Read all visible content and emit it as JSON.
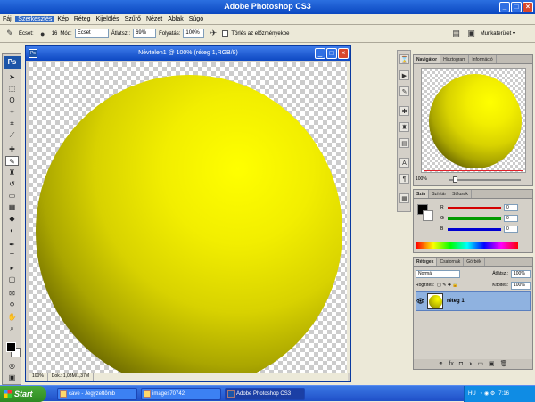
{
  "app": {
    "title": "Adobe Photoshop CS3",
    "logo": "Ps"
  },
  "menu": [
    "Fájl",
    "Szerkesztés",
    "Kép",
    "Réteg",
    "Kijelölés",
    "Szűrő",
    "Nézet",
    "Ablak",
    "Súgó"
  ],
  "options": {
    "brush_label": "Ecset:",
    "brush_size": "16",
    "mode_label": "Mód:",
    "mode_value": "Ecset",
    "opacity_label": "Átlátsz.:",
    "opacity_value": "69%",
    "flow_label": "Folyatás:",
    "flow_value": "100%",
    "erase_history": "Törlés az előzményekbe",
    "workspace": "Munkaterület ▾"
  },
  "document": {
    "title": "Névtelen1 @ 100% (réteg 1,RGB/8)",
    "zoom": "100%",
    "doc_info": "Dok.: 1,03M/1,37M"
  },
  "navigator": {
    "tabs": [
      "Navigátor",
      "Hisztogram",
      "Információ"
    ],
    "zoom": "100%"
  },
  "color": {
    "tabs": [
      "Szín",
      "Színtár",
      "Stílusok"
    ],
    "channels": [
      {
        "label": "R",
        "value": "0",
        "color": "#d40000"
      },
      {
        "label": "G",
        "value": "0",
        "color": "#009a00"
      },
      {
        "label": "B",
        "value": "0",
        "color": "#0000d0"
      }
    ]
  },
  "layers": {
    "tabs": [
      "Rétegek",
      "Csatornák",
      "Görbék"
    ],
    "blend_mode": "Normál",
    "opacity_label": "Átlátsz.:",
    "opacity_value": "100%",
    "lock_label": "Rögzítés:",
    "fill_label": "Kitöltés:",
    "fill_value": "100%",
    "items": [
      {
        "name": "réteg 1"
      }
    ]
  },
  "taskbar": {
    "start": "Start",
    "tasks": [
      {
        "label": "cave - Jegyzettömb",
        "active": false
      },
      {
        "label": "images70742",
        "active": false
      },
      {
        "label": "Adobe Photoshop CS3",
        "active": true
      }
    ],
    "lang": "HU",
    "time": "7:16"
  },
  "colors": {
    "accent": "#0a47c0",
    "sphere": "#ffff00"
  }
}
